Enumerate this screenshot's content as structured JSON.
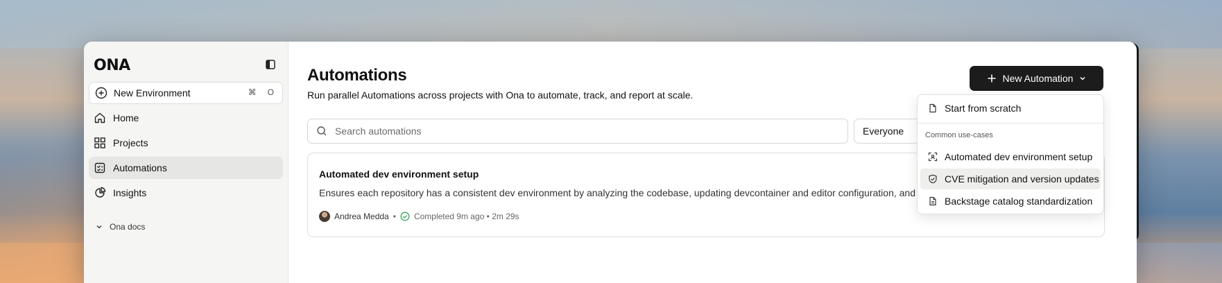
{
  "sidebar": {
    "logo": "ONA",
    "new_env": {
      "label": "New Environment",
      "kbd_1": "⌘",
      "kbd_2": "O"
    },
    "nav": [
      {
        "label": "Home",
        "icon": "home-icon"
      },
      {
        "label": "Projects",
        "icon": "grid-icon"
      },
      {
        "label": "Automations",
        "icon": "automations-icon",
        "active": true
      },
      {
        "label": "Insights",
        "icon": "pie-chart-icon"
      }
    ],
    "docs_label": "Ona docs"
  },
  "main": {
    "title": "Automations",
    "subtitle": "Run parallel Automations across projects with Ona to automate, track, and report at scale.",
    "new_button_label": "New Automation",
    "search_placeholder": "Search automations",
    "filter_value": "Everyone"
  },
  "card": {
    "title": "Automated dev environment setup",
    "description": "Ensures each repository has a consistent dev environment by analyzing the codebase, updating devcontainer and editor configuration, and op",
    "author": "Andrea Medda",
    "dot": "•",
    "status": "Completed 9m ago • 2m 29s"
  },
  "dropdown": {
    "start_label": "Start from scratch",
    "section_label": "Common use-cases",
    "items": [
      {
        "label": "Automated dev environment setup",
        "icon": "scan-icon"
      },
      {
        "label": "CVE mitigation and version updates",
        "icon": "shield-check-icon"
      },
      {
        "label": "Backstage catalog standardization",
        "icon": "file-text-icon"
      }
    ]
  },
  "colors": {
    "accent_dark": "#1c1c1c",
    "success": "#3aa55d",
    "sidebar_bg": "#f5f5f4"
  }
}
